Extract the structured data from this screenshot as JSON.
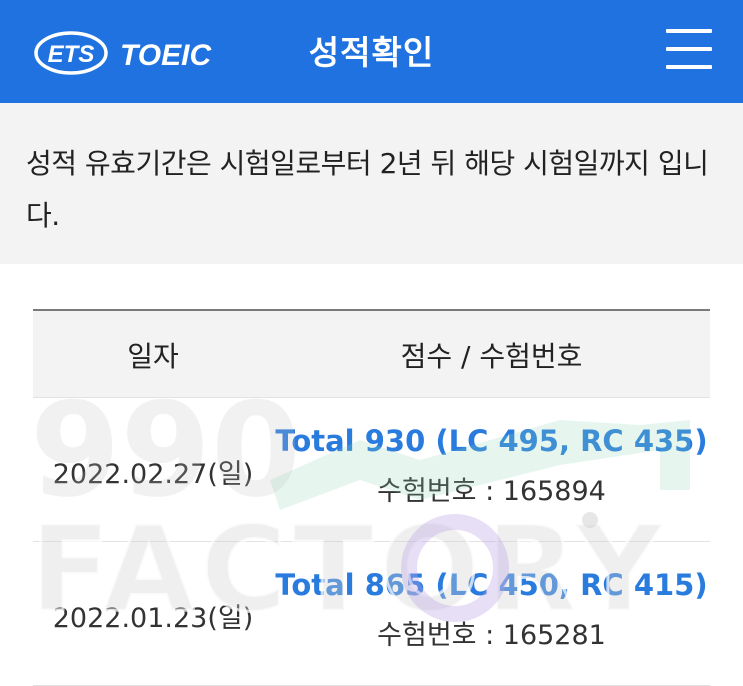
{
  "header": {
    "logo_ets": "ETS",
    "logo_toeic": "TOEIC",
    "title": "성적확인",
    "menu_icon": "hamburger-menu-icon"
  },
  "notice": {
    "text": "성적 유효기간은 시험일로부터 2년 뒤 해당 시험일까지 입니다."
  },
  "table": {
    "headers": {
      "date": "일자",
      "score": "점수 / 수험번호"
    },
    "rows": [
      {
        "date": "2022.02.27(일)",
        "score": "Total 930 (LC 495, RC 435)",
        "reg": "수험번호 : 165894"
      },
      {
        "date": "2022.01.23(일)",
        "score": "Total 865 (LC 450, RC 415)",
        "reg": "수험번호 : 165281"
      }
    ]
  },
  "watermark": {
    "number": "990",
    "word": "FACTORY"
  },
  "colors": {
    "header_bg": "#1f72e0",
    "link": "#2a7bde",
    "notice_bg": "#f3f3f3"
  }
}
